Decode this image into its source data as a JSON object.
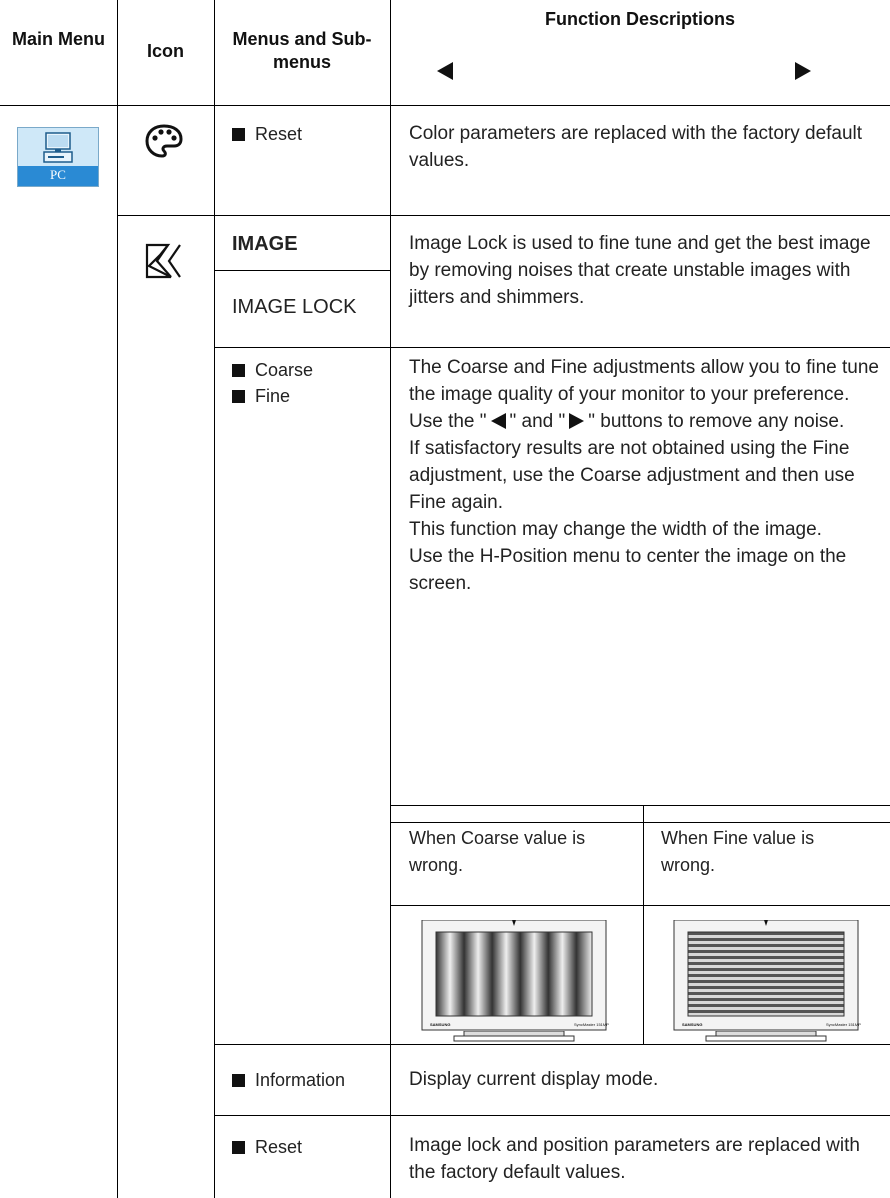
{
  "header": {
    "main_menu": "Main Menu",
    "icon": "Icon",
    "menus": "Menus and Sub-menus",
    "function": "Function Descriptions"
  },
  "main_menu": {
    "icon": "pc-icon",
    "label": "PC"
  },
  "rows": {
    "color_reset": {
      "submenu": "Reset",
      "description": "Color parameters are replaced with the factory default values."
    },
    "image": {
      "menu": "IMAGE",
      "submenu": "IMAGE LOCK",
      "description": "Image Lock is used to fine tune and get the best image by removing noises that create unstable images with jitters and shimmers."
    },
    "coarse_fine": {
      "items": [
        "Coarse",
        "Fine"
      ],
      "desc_1": "The Coarse and Fine adjustments allow you to fine tune the image quality of your monitor to your preference.",
      "desc_2a": "Use the \"",
      "desc_2b": "\" and \"",
      "desc_2c": "\" buttons to remove any noise.",
      "desc_3": "If satisfactory results are not obtained using the Fine adjustment, use the Coarse adjustment and then use Fine again.",
      "desc_4": "This function may change the width of the image.",
      "desc_5": "Use the H-Position menu to center the image on the screen.",
      "caption_coarse": "When Coarse value is wrong.",
      "caption_fine": "When Fine value is wrong."
    },
    "information": {
      "submenu": "Information",
      "description": "Display current display mode."
    },
    "image_reset": {
      "submenu": "Reset",
      "description": "Image lock and position parameters are replaced with the factory default values."
    }
  },
  "monitor": {
    "brand": "SAMSUNG",
    "model": "SyncMaster 151MP"
  },
  "icons": [
    "palette-icon",
    "image-lock-icon",
    "left-arrow-icon",
    "right-arrow-icon"
  ]
}
